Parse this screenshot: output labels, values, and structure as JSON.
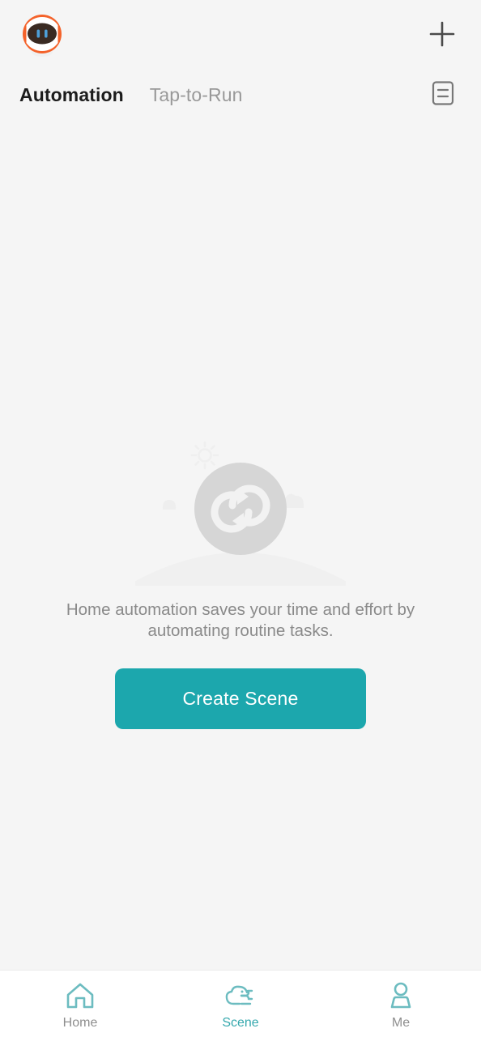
{
  "app": {
    "logo_icon": "robot-face-logo",
    "background_color": "#f5f5f5",
    "accent_color": "#1ca7ad"
  },
  "topbar": {
    "add_icon": "plus-icon",
    "add_label": "+"
  },
  "tabs": {
    "items": [
      {
        "label": "Automation",
        "active": true
      },
      {
        "label": "Tap-to-Run",
        "active": false
      }
    ],
    "log_icon": "log-records-icon"
  },
  "empty_state": {
    "illustration_icon": "automation-loop-illustration",
    "message": "Home automation saves your time and effort by automating routine tasks.",
    "cta_label": "Create Scene",
    "cta_color": "#1ca7ad"
  },
  "bottom_nav": {
    "items": [
      {
        "label": "Home",
        "icon": "house-icon",
        "active": false
      },
      {
        "label": "Scene",
        "icon": "cloud-scene-icon",
        "active": true
      },
      {
        "label": "Me",
        "icon": "person-icon",
        "active": false
      }
    ],
    "active_color": "#35a8ad",
    "inactive_color": "#8e8e8e"
  }
}
